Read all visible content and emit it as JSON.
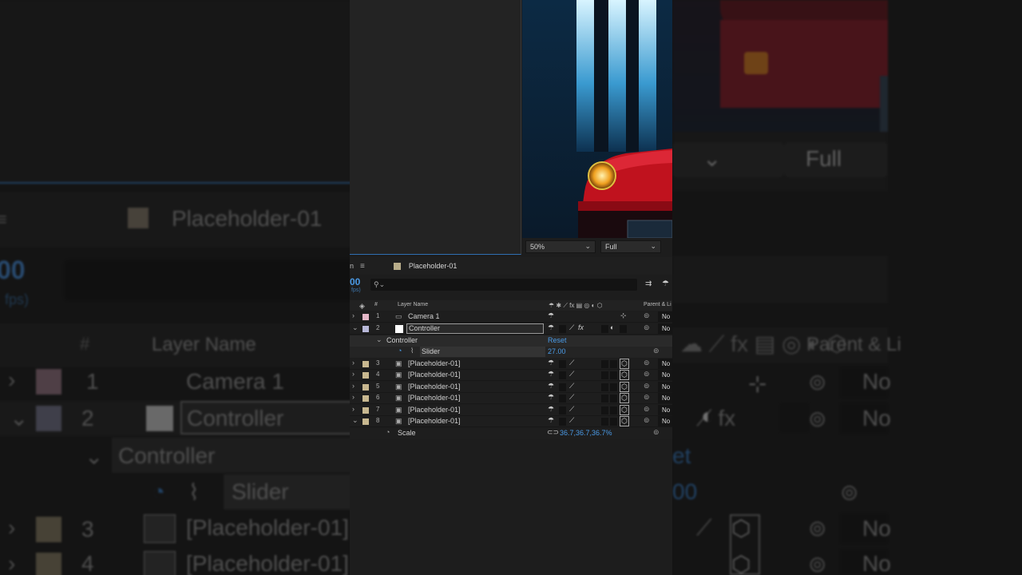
{
  "timeline": {
    "comp_name": "Placeholder-01",
    "timecode": "00",
    "fps_label": "fps)",
    "search_placeholder": "",
    "columns": {
      "number": "#",
      "layer_name": "Layer Name",
      "parent": "Parent & Li"
    },
    "layers": [
      {
        "num": "1",
        "name": "Camera 1",
        "label_color": "#e5b8c8",
        "type": "camera-icon",
        "parent": "No"
      },
      {
        "num": "2",
        "name": "Controller",
        "label_color": "#b8b8d8",
        "type": "solid-icon",
        "parent": "No"
      },
      {
        "num": "3",
        "name": "[Placeholder-01]",
        "label_color": "#c8b890",
        "type": "footage-icon",
        "parent": "No"
      },
      {
        "num": "4",
        "name": "[Placeholder-01]",
        "label_color": "#c8b890",
        "type": "footage-icon",
        "parent": "No"
      },
      {
        "num": "5",
        "name": "[Placeholder-01]",
        "label_color": "#c8b890",
        "type": "footage-icon",
        "parent": "No"
      },
      {
        "num": "6",
        "name": "[Placeholder-01]",
        "label_color": "#c8b890",
        "type": "footage-icon",
        "parent": "No"
      },
      {
        "num": "7",
        "name": "[Placeholder-01]",
        "label_color": "#c8b890",
        "type": "footage-icon",
        "parent": "No"
      },
      {
        "num": "8",
        "name": "[Placeholder-01]",
        "label_color": "#c8b890",
        "type": "footage-icon",
        "parent": "No"
      }
    ],
    "effect": {
      "name": "Controller",
      "reset": "Reset",
      "slider_label": "Slider",
      "slider_value": "27.00"
    },
    "scale": {
      "label": "Scale",
      "value": "36.7,36.7,36.7%"
    }
  },
  "viewer": {
    "zoom": "50%",
    "resolution": "Full"
  },
  "colors": {
    "accent": "#4a9ae6",
    "panel": "#1d1d1d",
    "car_red": "#c0121e"
  }
}
